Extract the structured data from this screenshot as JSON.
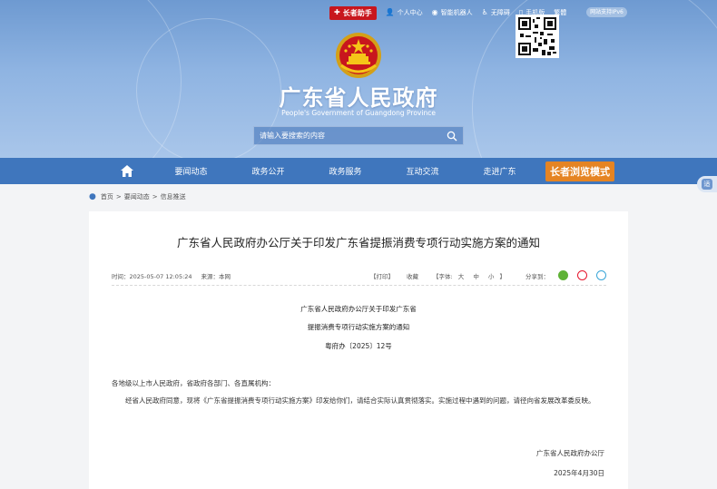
{
  "topbar": {
    "helper": "长者助手",
    "personal_center": "个人中心",
    "robot": "智能机器人",
    "accessibility": "无障碍",
    "mobile": "手机版",
    "weibo": "繁體",
    "ipv6": "网站支持IPv6"
  },
  "header": {
    "title": "广东省人民政府",
    "subtitle": "People's Government of Guangdong Province",
    "search_placeholder": "请输入要搜索的内容"
  },
  "nav": {
    "items": [
      "要闻动态",
      "政务公开",
      "政务服务",
      "互动交流",
      "走进广东"
    ],
    "elder_mode": "长者浏览模式"
  },
  "side": {
    "label": "适"
  },
  "breadcrumb": [
    "首页",
    ">",
    "要闻动态",
    ">",
    "信息推送"
  ],
  "article": {
    "title": "广东省人民政府办公厅关于印发广东省提振消费专项行动实施方案的通知",
    "time": "时间：2025-05-07 12:05:24",
    "source": "来源：本网",
    "print": "【打印】",
    "favorite": "收藏",
    "font_label": "【字体:",
    "font_big": "大",
    "font_mid": "中",
    "font_small": "小",
    "font_end": "】",
    "share": "分享到：",
    "doc_heading_1": "广东省人民政府办公厅关于印发广东省",
    "doc_heading_2": "提振消费专项行动实施方案的通知",
    "doc_number": "粤府办〔2025〕12号",
    "addressee": "各地级以上市人民政府，省政府各部门、各直属机构：",
    "body": "经省人民政府同意，现将《广东省提振消费专项行动实施方案》印发给你们，请结合实际认真贯彻落实。实施过程中遇到的问题，请径向省发展改革委反映。",
    "signer": "广东省人民政府办公厅",
    "date": "2025年4月30日"
  },
  "colors": {
    "nav_bg": "#3f76bd",
    "helper_red": "#c8161d",
    "elder_orange": "#e58423"
  }
}
